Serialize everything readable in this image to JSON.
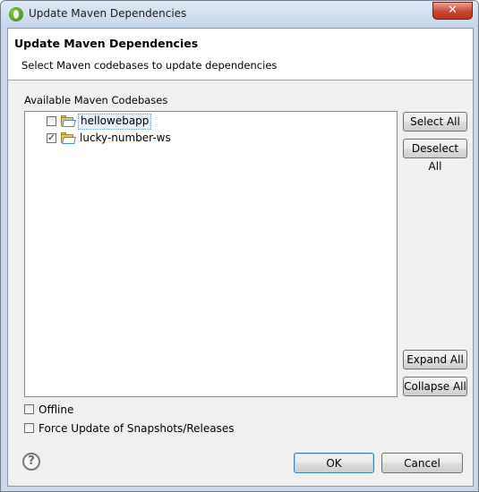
{
  "window": {
    "title": "Update Maven Dependencies",
    "close_glyph": "✕"
  },
  "header": {
    "title": "Update Maven Dependencies",
    "description": "Select Maven codebases to update dependencies"
  },
  "codebases": {
    "label": "Available Maven Codebases",
    "items": [
      {
        "name": "hellowebapp",
        "checked": "",
        "selected": true,
        "icon": "maven-folder-icon"
      },
      {
        "name": "lucky-number-ws",
        "checked": "✓",
        "selected": false,
        "icon": "maven-folder-icon"
      }
    ]
  },
  "side_buttons": {
    "select_all": "Select All",
    "deselect_all": "Deselect All",
    "expand_all": "Expand All",
    "collapse_all": "Collapse All"
  },
  "options": {
    "offline": {
      "label": "Offline",
      "checked": ""
    },
    "force_update": {
      "label": "Force Update of Snapshots/Releases",
      "checked": ""
    }
  },
  "footer": {
    "help_glyph": "?",
    "ok": "OK",
    "cancel": "Cancel"
  },
  "colors": {
    "titlebar": "#c4d5ea",
    "close_button": "#c9452f",
    "dialog_bg": "#f0f0f0",
    "default_button_border": "#3c7fb1"
  }
}
